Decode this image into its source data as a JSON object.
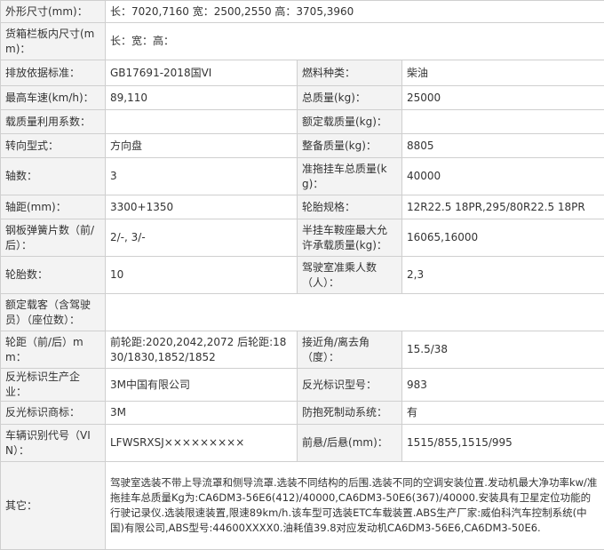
{
  "rows": [
    {
      "type": "wide",
      "label": "外形尺寸(mm)：",
      "value": "长：7020,7160 宽：2500,2550 高：3705,3960"
    },
    {
      "type": "wide",
      "label": "货箱栏板内尺寸(mm)：",
      "value": "长：宽：高："
    },
    {
      "type": "pair",
      "l1": "排放依据标准：",
      "v1": "GB17691-2018国VI",
      "l2": "燃料种类：",
      "v2": "柴油"
    },
    {
      "type": "pair",
      "l1": "最高车速(km/h)：",
      "v1": "89,110",
      "l2": "总质量(kg)：",
      "v2": "25000"
    },
    {
      "type": "pair",
      "l1": "载质量利用系数：",
      "v1": "",
      "l2": "额定载质量(kg)：",
      "v2": ""
    },
    {
      "type": "pair",
      "l1": "转向型式：",
      "v1": "方向盘",
      "l2": "整备质量(kg)：",
      "v2": "8805"
    },
    {
      "type": "pair",
      "l1": "轴数：",
      "v1": "3",
      "l2": "准拖挂车总质量(kg)：",
      "v2": "40000"
    },
    {
      "type": "pair",
      "l1": "轴距(mm)：",
      "v1": "3300+1350",
      "l2": "轮胎规格：",
      "v2": "12R22.5 18PR,295/80R22.5 18PR"
    },
    {
      "type": "pair",
      "l1": "钢板弹簧片数（前/后）：",
      "v1": "2/-, 3/-",
      "l2": "半挂车鞍座最大允许承载质量(kg)：",
      "v2": "16065,16000"
    },
    {
      "type": "pair",
      "l1": "轮胎数：",
      "v1": "10",
      "l2": "驾驶室准乘人数（人）：",
      "v2": "2,3"
    },
    {
      "type": "wide",
      "label": "额定载客（含驾驶员）（座位数）：",
      "value": ""
    },
    {
      "type": "pair",
      "l1": "轮距（前/后）mm：",
      "v1": "前轮距:2020,2042,2072 后轮距:1830/1830,1852/1852",
      "l2": "接近角/离去角（度）：",
      "v2": "15.5/38"
    },
    {
      "type": "pair",
      "l1": "反光标识生产企业：",
      "v1": "3M中国有限公司",
      "l2": "反光标识型号：",
      "v2": "983"
    },
    {
      "type": "pair",
      "l1": "反光标识商标：",
      "v1": "3M",
      "l2": "防抱死制动系统：",
      "v2": "有"
    },
    {
      "type": "pair",
      "l1": "车辆识别代号（VIN）：",
      "v1": "LFWSRXSJ×××××××××",
      "l2": "前悬/后悬(mm)：",
      "v2": "1515/855,1515/995"
    },
    {
      "type": "wide",
      "label": "其它：",
      "value": "驾驶室选装不带上导流罩和侧导流罩.选装不同结构的后围.选装不同的空调安装位置.发动机最大净功率kw/准拖挂车总质量Kg为:CA6DM3-56E6(412)/40000,CA6DM3-50E6(367)/40000.安装具有卫星定位功能的行驶记录仪.选装限速装置,限速89km/h.该车型可选装ETC车载装置.ABS生产厂家:威伯科汽车控制系统(中国)有限公司,ABS型号:44600XXXX0.油耗值39.8对应发动机CA6DM3-56E6,CA6DM3-50E6."
    }
  ]
}
